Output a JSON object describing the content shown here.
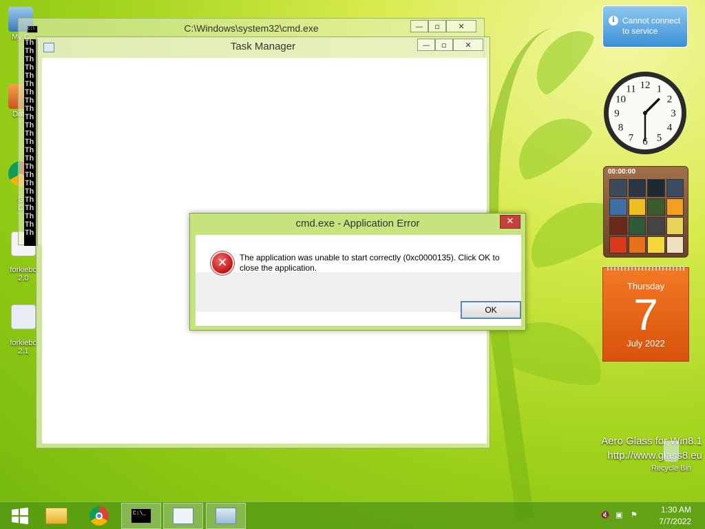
{
  "desktop": {
    "icons": [
      {
        "label": "My C"
      },
      {
        "label": "Data"
      },
      {
        "label": "G\nC"
      },
      {
        "label": "forkiebo\n2.0"
      },
      {
        "label": "forkiebo\n2.1"
      }
    ]
  },
  "cmd_window": {
    "title": "C:\\Windows\\system32\\cmd.exe",
    "console_lines": [
      "Th",
      "Th",
      "Th",
      "Th",
      "Th",
      "Th",
      "Th",
      "Th",
      "Th",
      "Th",
      "Th",
      "Th",
      "Th",
      "Th",
      "Th",
      "Th",
      "Th",
      "Th",
      "Th",
      "Th",
      "Th",
      "Th",
      "Th",
      "Th"
    ],
    "minimize": "—",
    "maximize": "▫",
    "close": "✕"
  },
  "task_manager": {
    "title": "Task Manager",
    "minimize": "—",
    "maximize": "▫",
    "close": "✕"
  },
  "error_dialog": {
    "title": "cmd.exe - Application Error",
    "close": "✕",
    "message": "The application was unable to start correctly (0xc0000135). Click OK to close the application.",
    "ok_label": "OK"
  },
  "gadgets": {
    "notification": "Cannot connect to service",
    "puzzle_timer": "00:00:00",
    "calendar": {
      "weekday": "Thursday",
      "day": "7",
      "month_year": "July 2022"
    },
    "clock": {
      "hour": 1,
      "minute": 30,
      "numbers": [
        "12",
        "1",
        "2",
        "3",
        "4",
        "5",
        "6",
        "7",
        "8",
        "9",
        "10",
        "11"
      ]
    }
  },
  "watermark": {
    "line1": "Aero Glass for Win8.1",
    "line2": "http://www.glass8.eu"
  },
  "recycle_bin": {
    "label": "Recycle Bin"
  },
  "taskbar": {
    "time": "1:30 AM",
    "date": "7/7/2022",
    "apps": [
      "file-explorer",
      "chrome",
      "cmd",
      "task-manager",
      "resource-monitor"
    ]
  },
  "colors": {
    "accent_green": "#9fd21a",
    "error_red": "#c21414",
    "calendar_orange": "#f27a24"
  }
}
